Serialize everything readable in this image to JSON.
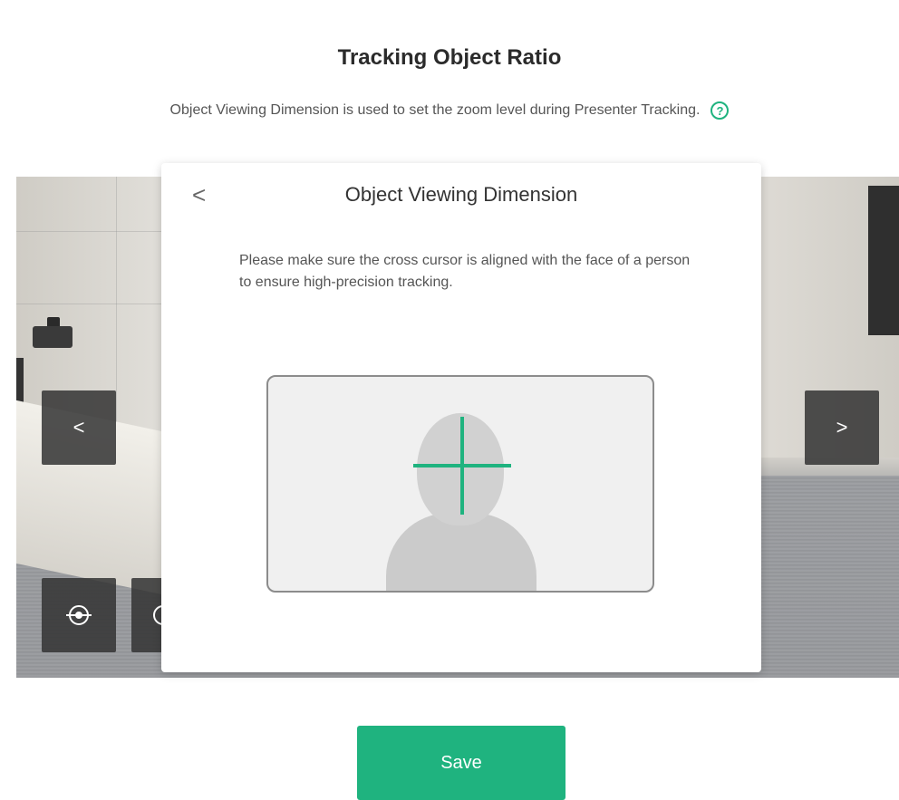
{
  "page": {
    "title": "Tracking Object Ratio",
    "subtitle": "Object Viewing Dimension is used to set the zoom level during Presenter Tracking.",
    "help_icon": "?"
  },
  "camera_nav": {
    "prev_label": "<",
    "next_label": ">"
  },
  "modal": {
    "back_label": "<",
    "title": "Object Viewing Dimension",
    "instruction": "Please make sure the cross cursor is aligned with the face of a person to ensure high-precision tracking."
  },
  "actions": {
    "save_label": "Save"
  },
  "colors": {
    "accent": "#1fb37f",
    "nav_button_bg": "#323232"
  },
  "icons": {
    "help": "help-icon",
    "back": "chevron-left-icon",
    "prev": "chevron-left-icon",
    "next": "chevron-right-icon",
    "target": "target-icon",
    "ring": "ring-icon",
    "crosshair": "crosshair-icon"
  }
}
